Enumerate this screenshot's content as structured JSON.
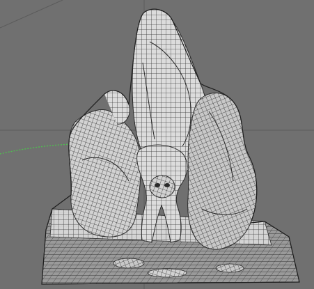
{
  "viewport": {
    "background_color": "#707070",
    "grid_line_color": "#5a5a5a",
    "axis_line_color": "#4fbf4f",
    "mesh_fill_color": "#d9d9d9",
    "mesh_wire_color": "#3a3a3a",
    "object_kind": "wireframe-sculpt-mesh"
  }
}
